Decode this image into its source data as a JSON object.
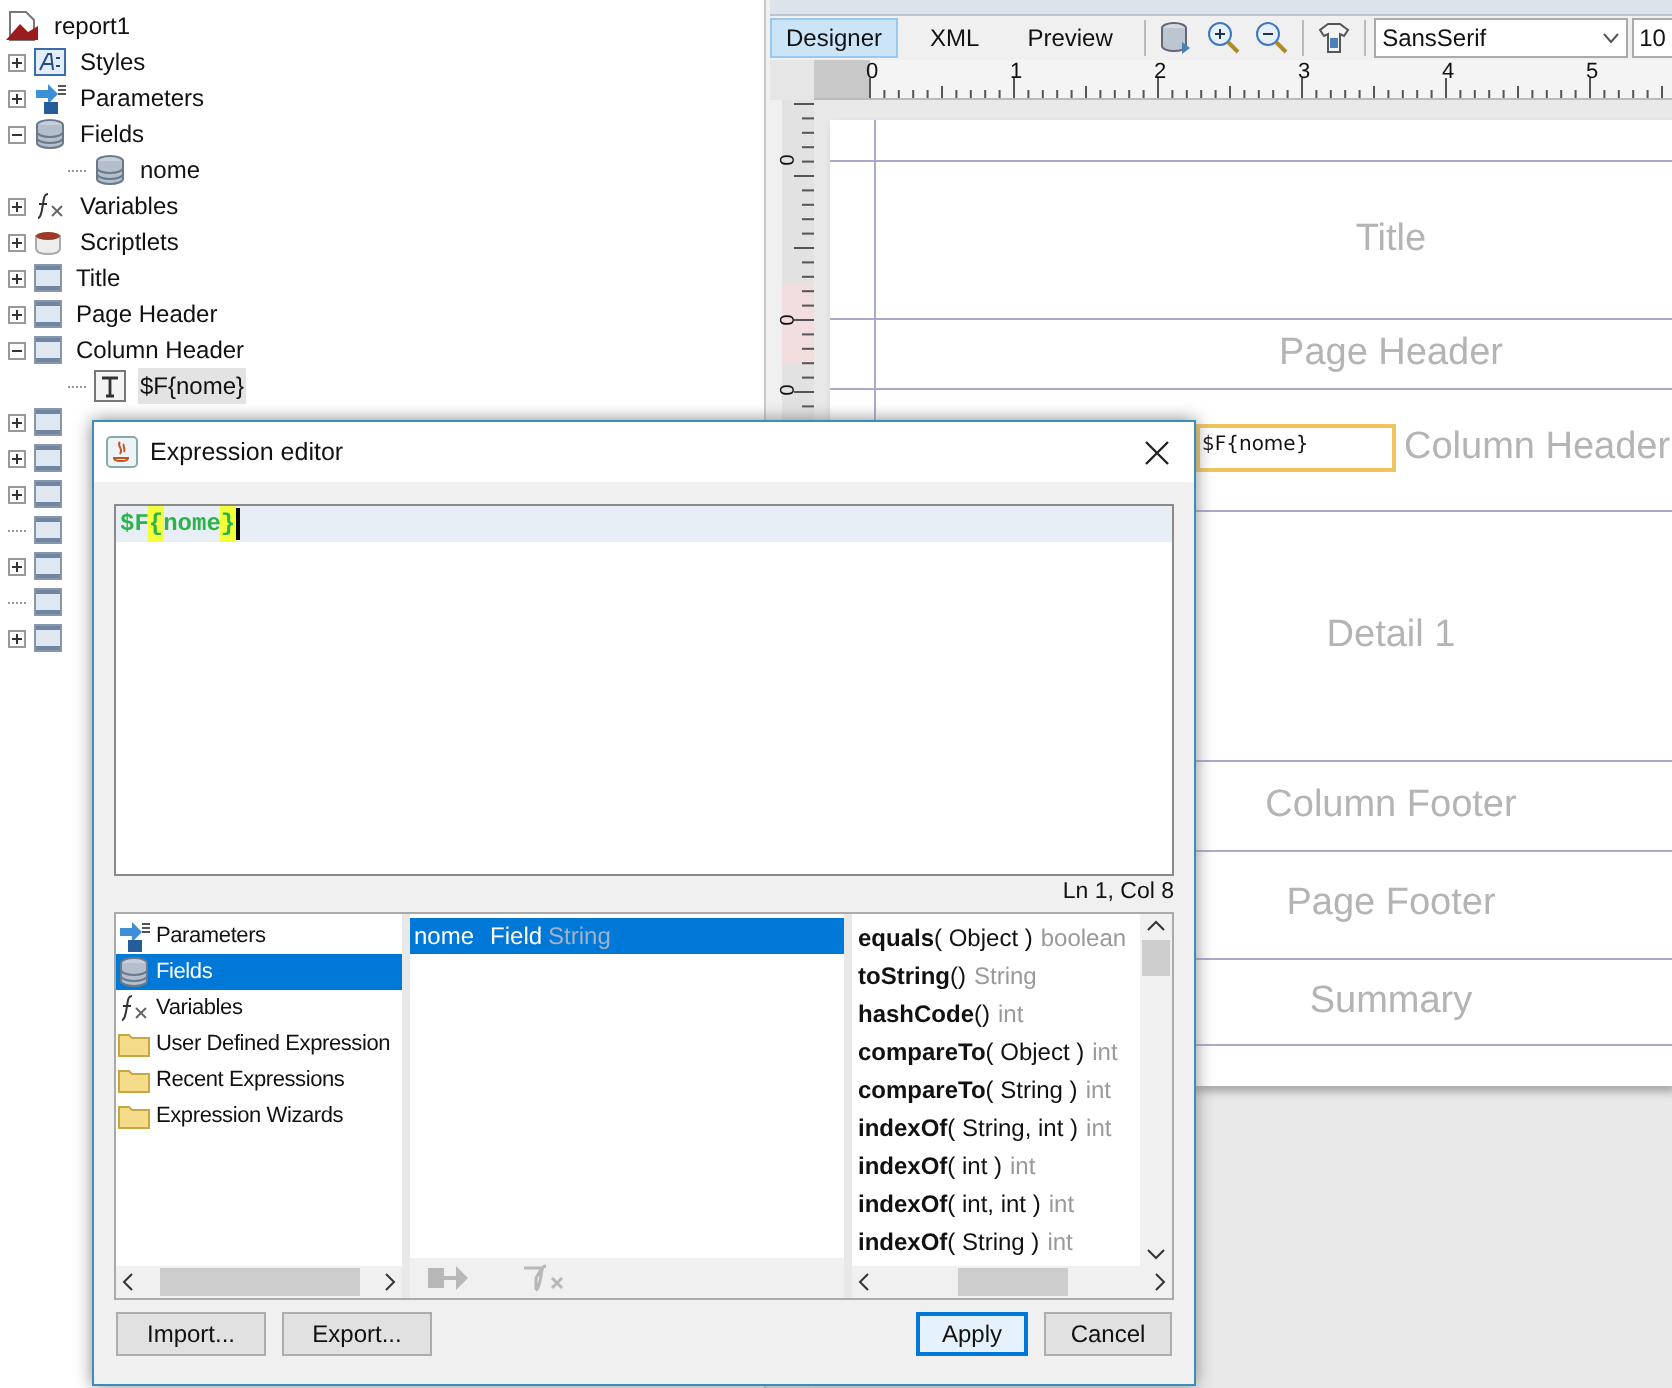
{
  "report_tree": [
    {
      "label": "report1",
      "kind": "report",
      "children": [
        {
          "label": "Styles",
          "kind": "styles",
          "expanded": false
        },
        {
          "label": "Parameters",
          "kind": "parameters",
          "expanded": false
        },
        {
          "label": "Fields",
          "kind": "fields",
          "expanded": true,
          "children": [
            {
              "label": "nome",
              "kind": "field"
            }
          ]
        },
        {
          "label": "Variables",
          "kind": "variables",
          "expanded": false
        },
        {
          "label": "Scriptlets",
          "kind": "scriptlets",
          "expanded": false
        },
        {
          "label": "Title",
          "kind": "band",
          "expanded": false
        },
        {
          "label": "Page Header",
          "kind": "band",
          "expanded": false
        },
        {
          "label": "Column Header",
          "kind": "band",
          "expanded": true,
          "children": [
            {
              "label": "$F{nome}",
              "kind": "textfield",
              "selected": true
            }
          ]
        },
        {
          "kind": "band",
          "expanded": false
        },
        {
          "kind": "band",
          "expanded": false
        },
        {
          "kind": "band",
          "expanded": false
        },
        {
          "kind": "band"
        },
        {
          "kind": "band",
          "expanded": false
        },
        {
          "kind": "band"
        },
        {
          "kind": "band",
          "expanded": false
        }
      ]
    }
  ],
  "designer": {
    "view_tabs": [
      {
        "label": "Designer",
        "selected": true
      },
      {
        "label": "XML",
        "selected": false
      },
      {
        "label": "Preview",
        "selected": false
      }
    ],
    "font_name": "SansSerif",
    "font_size": "10",
    "ruler_labels": [
      "0",
      "1",
      "2",
      "3",
      "4",
      "5"
    ],
    "vertical_ruler_labels": [
      "0",
      "0",
      "0"
    ],
    "bands": [
      {
        "label": "Title"
      },
      {
        "label": "Page Header"
      },
      {
        "label": "Column Header"
      },
      {
        "label": "Detail 1"
      },
      {
        "label": "Column Footer"
      },
      {
        "label": "Page Footer"
      },
      {
        "label": "Summary"
      }
    ],
    "selected_element": {
      "text": "$F{nome}"
    }
  },
  "expression_editor": {
    "title": "Expression editor",
    "tokens": [
      {
        "text": "$F",
        "matched": false
      },
      {
        "text": "{",
        "matched": true
      },
      {
        "text": "nome",
        "matched": false
      },
      {
        "text": "}",
        "matched": true
      }
    ],
    "cursor_position": "Ln 1, Col 8",
    "categories": [
      {
        "label": "Parameters",
        "kind": "parameters",
        "selected": false
      },
      {
        "label": "Fields",
        "kind": "fields",
        "selected": true
      },
      {
        "label": "Variables",
        "kind": "variables",
        "selected": false
      },
      {
        "label": "User Defined Expression",
        "kind": "folder",
        "selected": false
      },
      {
        "label": "Recent Expressions",
        "kind": "folder",
        "selected": false
      },
      {
        "label": "Expression Wizards",
        "kind": "folder",
        "selected": false
      }
    ],
    "objects": [
      {
        "name": "nome",
        "type": "Field",
        "class": "String",
        "selected": true
      }
    ],
    "methods": [
      {
        "name": "equals",
        "args": "( Object )",
        "returns": "boolean"
      },
      {
        "name": "toString",
        "args": "()",
        "returns": "String"
      },
      {
        "name": "hashCode",
        "args": "()",
        "returns": "int"
      },
      {
        "name": "compareTo",
        "args": "( Object )",
        "returns": "int"
      },
      {
        "name": "compareTo",
        "args": "( String )",
        "returns": "int"
      },
      {
        "name": "indexOf",
        "args": "( String, int )",
        "returns": "int"
      },
      {
        "name": "indexOf",
        "args": "( int )",
        "returns": "int"
      },
      {
        "name": "indexOf",
        "args": "( int, int )",
        "returns": "int"
      },
      {
        "name": "indexOf",
        "args": "( String )",
        "returns": "int"
      }
    ],
    "buttons_left": [
      "Import...",
      "Export..."
    ],
    "buttons_right": [
      {
        "label": "Apply",
        "default": true
      },
      {
        "label": "Cancel",
        "default": false
      }
    ]
  }
}
